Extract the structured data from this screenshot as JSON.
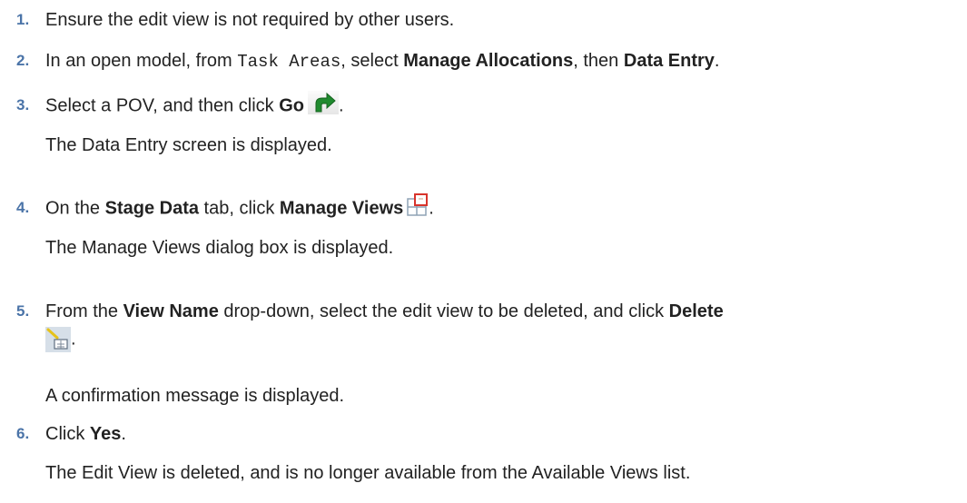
{
  "steps": [
    {
      "number": "1.",
      "text": "Ensure the edit view is not required by other users."
    },
    {
      "number": "2.",
      "pre": "In an open model, from ",
      "code": "Task Areas",
      "mid": ", select ",
      "b1": "Manage Allocations",
      "mid2": ", then ",
      "b2": "Data Entry",
      "post": "."
    },
    {
      "number": "3.",
      "pre": "Select a POV, and then click ",
      "b1": "Go",
      "post": ".",
      "result": "The Data Entry screen is displayed."
    },
    {
      "number": "4.",
      "pre": "On the ",
      "b1": "Stage Data",
      "mid": " tab, click ",
      "b2": "Manage Views",
      "post": ".",
      "result": "The Manage Views dialog box is displayed."
    },
    {
      "number": "5.",
      "pre": "From the ",
      "b1": "View Name",
      "mid": " drop-down, select the edit view to be deleted, and click ",
      "b2": "Delete",
      "post": ".",
      "result": "A confirmation message is displayed."
    },
    {
      "number": "6.",
      "pre": "Click ",
      "b1": "Yes",
      "post": ".",
      "result": "The Edit View is deleted, and is no longer available from the Available Views list."
    }
  ],
  "icons": {
    "go": "go-arrow-icon",
    "manage_views": "manage-views-icon",
    "delete": "delete-view-icon"
  },
  "colors": {
    "step_number": "#4b74a8",
    "text": "#222222",
    "go_arrow": "#1f8a2e",
    "manage_views_accent": "#d8342c"
  }
}
